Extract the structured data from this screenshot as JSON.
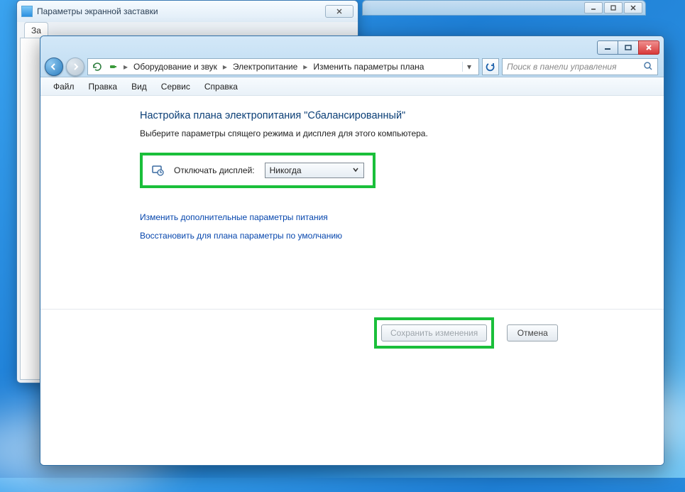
{
  "bg_window": {
    "title": "Параметры экранной заставки",
    "tab": "За"
  },
  "main_window": {
    "breadcrumbs": [
      "Оборудование и звук",
      "Электропитание",
      "Изменить параметры плана"
    ],
    "search_placeholder": "Поиск в панели управления",
    "menu": {
      "file": "Файл",
      "edit": "Правка",
      "view": "Вид",
      "service": "Сервис",
      "help": "Справка"
    },
    "heading": "Настройка плана электропитания \"Сбалансированный\"",
    "subheading": "Выберите параметры спящего режима и дисплея для этого компьютера.",
    "display_off_label": "Отключать дисплей:",
    "display_off_value": "Никогда",
    "link_advanced": "Изменить дополнительные параметры питания",
    "link_restore": "Восстановить для плана параметры по умолчанию",
    "btn_save": "Сохранить изменения",
    "btn_cancel": "Отмена"
  }
}
